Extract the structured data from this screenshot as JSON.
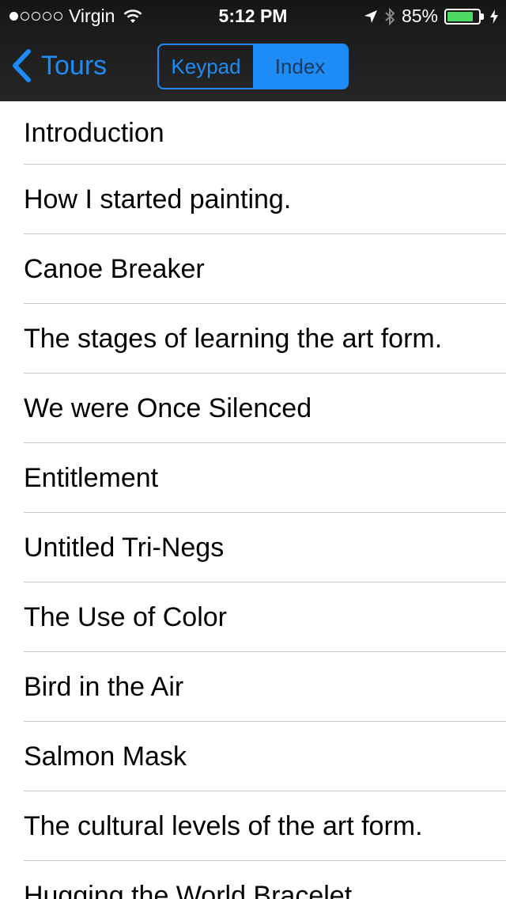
{
  "status_bar": {
    "carrier": "Virgin",
    "signal_dots_filled": 1,
    "signal_dots_total": 5,
    "time": "5:12 PM",
    "battery_percent": "85%",
    "battery_level": 0.85,
    "battery_color": "#4cd964",
    "icons": [
      "wifi-icon",
      "location-arrow-icon",
      "bluetooth-icon",
      "battery-icon",
      "charging-bolt-icon"
    ]
  },
  "nav": {
    "back_label": "Tours",
    "segments": [
      {
        "label": "Keypad",
        "selected": false
      },
      {
        "label": "Index",
        "selected": true
      }
    ],
    "accent_color": "#1e8cf6"
  },
  "list": {
    "items": [
      "Introduction",
      "How I started painting.",
      "Canoe Breaker",
      "The stages of learning the art form.",
      "We were Once Silenced",
      "Entitlement",
      "Untitled Tri-Negs",
      "The Use of Color",
      "Bird in the Air",
      "Salmon Mask",
      "The cultural levels of the art form.",
      "Hugging the World Bracelet"
    ]
  }
}
